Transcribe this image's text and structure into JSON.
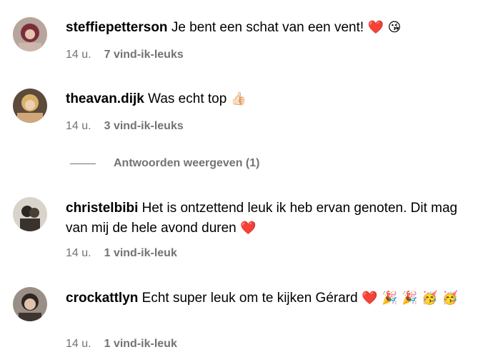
{
  "comments": [
    {
      "username": "steffiepetterson",
      "text": "Je bent een schat van een vent!",
      "emojis": "❤️ 😘",
      "time": "14 u.",
      "likes": "7 vind-ik-leuks"
    },
    {
      "username": "theavan.dijk",
      "text": "Was echt top",
      "emojis": "👍🏻",
      "time": "14 u.",
      "likes": "3 vind-ik-leuks"
    },
    {
      "username": "christelbibi",
      "text": "Het is ontzettend leuk ik heb ervan genoten. Dit mag van mij de hele avond duren",
      "emojis": "❤️",
      "time": "14 u.",
      "likes": "1 vind-ik-leuk"
    },
    {
      "username": "crockattlyn",
      "text": "Echt super leuk om te kijken Gérard",
      "emojis": "❤️ 🎉 🎉 🥳 🥳",
      "time": "14 u.",
      "likes": "1 vind-ik-leuk"
    }
  ],
  "replies_toggle": {
    "label": "Antwoorden weergeven (1)"
  },
  "colors": {
    "meta_text": "#737373",
    "heart": "#e0245e"
  }
}
